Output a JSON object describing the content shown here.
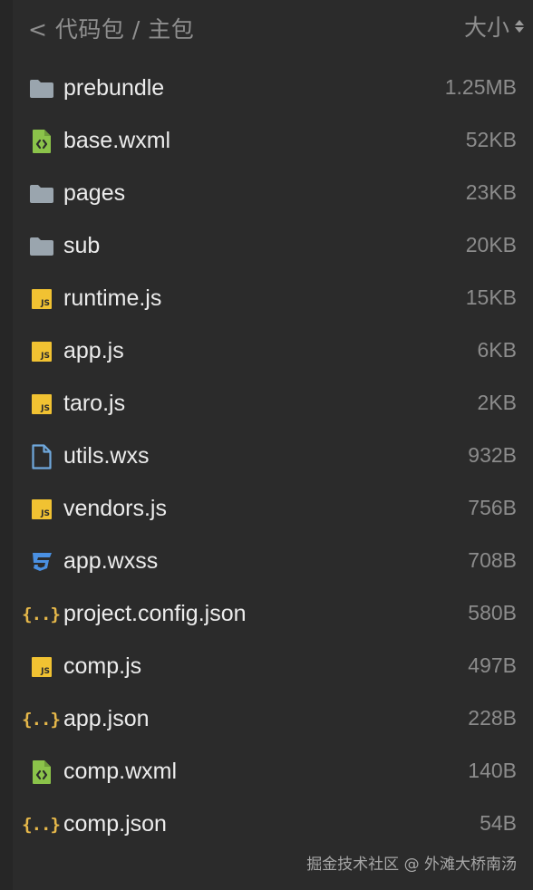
{
  "header": {
    "breadcrumb": "< 代码包 / 主包",
    "sort_label": "大小"
  },
  "files": [
    {
      "name": "prebundle",
      "size": "1.25MB",
      "icon": "folder-icon"
    },
    {
      "name": "base.wxml",
      "size": "52KB",
      "icon": "wxml-file-icon"
    },
    {
      "name": "pages",
      "size": "23KB",
      "icon": "folder-icon"
    },
    {
      "name": "sub",
      "size": "20KB",
      "icon": "folder-icon"
    },
    {
      "name": "runtime.js",
      "size": "15KB",
      "icon": "js-file-icon"
    },
    {
      "name": "app.js",
      "size": "6KB",
      "icon": "js-file-icon"
    },
    {
      "name": "taro.js",
      "size": "2KB",
      "icon": "js-file-icon"
    },
    {
      "name": "utils.wxs",
      "size": "932B",
      "icon": "file-icon"
    },
    {
      "name": "vendors.js",
      "size": "756B",
      "icon": "js-file-icon"
    },
    {
      "name": "app.wxss",
      "size": "708B",
      "icon": "css-file-icon"
    },
    {
      "name": "project.config.json",
      "size": "580B",
      "icon": "json-file-icon"
    },
    {
      "name": "comp.js",
      "size": "497B",
      "icon": "js-file-icon"
    },
    {
      "name": "app.json",
      "size": "228B",
      "icon": "json-file-icon"
    },
    {
      "name": "comp.wxml",
      "size": "140B",
      "icon": "wxml-file-icon"
    },
    {
      "name": "comp.json",
      "size": "54B",
      "icon": "json-file-icon"
    }
  ],
  "watermark": "掘金技术社区 @ 外滩大桥南汤",
  "colors": {
    "background": "#2b2b2b",
    "folder": "#9aa5ae",
    "js": "#f1c232",
    "wxml": "#8bc34a",
    "css": "#4a90e2",
    "json": "#e6b84a",
    "file": "#6fa8dc"
  }
}
